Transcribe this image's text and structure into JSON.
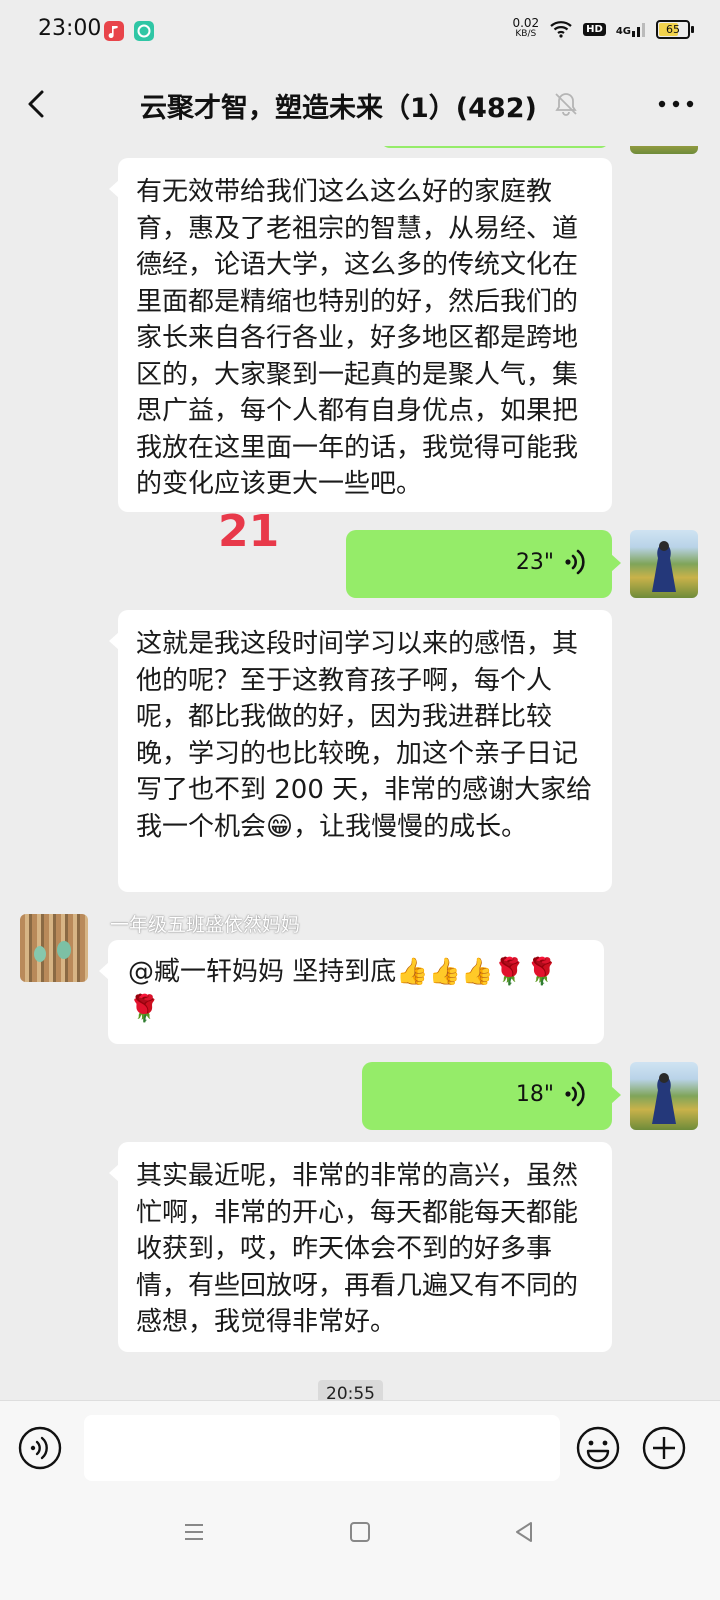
{
  "status_bar": {
    "time": "23:00",
    "net_speed_value": "0.02",
    "net_speed_unit": "KB/S",
    "hd_label": "HD",
    "network": "4G",
    "battery": "65",
    "app_icon_colors": [
      "#e8444a",
      "#2fc6a5"
    ]
  },
  "header": {
    "title": "云聚才智，塑造未来（1）(482)",
    "back_icon": "back-chevron-icon",
    "mute_icon": "bell-muted-icon",
    "more_icon": "more-dots-icon"
  },
  "messages": [
    {
      "type": "text",
      "side": "left",
      "text": "有无效带给我们这么这么好的家庭教育，惠及了老祖宗的智慧，从易经、道德经，论语大学，这么多的传统文化在里面都是精缩也特别的好，然后我们的家长来自各行各业，好多地区都是跨地区的，大家聚到一起真的是聚人气，集思广益，每个人都有自身优点，如果把我放在这里面一年的话，我觉得可能我的变化应该更大一些吧。"
    },
    {
      "type": "voice",
      "side": "right",
      "duration": "23\""
    },
    {
      "type": "text",
      "side": "left",
      "text": "这就是我这段时间学习以来的感悟，其他的呢？至于这教育孩子啊，每个人呢，都比我做的好，因为我进群比较晚，学习的也比较晚，加这个亲子日记写了也不到 200 天，非常的感谢大家给我一个机会😁，让我慢慢的成长。"
    },
    {
      "type": "text",
      "side": "left",
      "sender": "一年级五班盛依然妈妈",
      "text": "@臧一轩妈妈  坚持到底👍👍👍🌹🌹🌹"
    },
    {
      "type": "voice",
      "side": "right",
      "duration": "18\""
    },
    {
      "type": "text",
      "side": "left",
      "text": "其实最近呢，非常的非常的高兴，虽然忙啊，非常的开心，每天都能每天都能收获到，哎，昨天体会不到的好多事情，有些回放呀，再看几遍又有不同的感想，我觉得非常好。"
    }
  ],
  "overlay_marker": "21",
  "timestamp": "20:55",
  "input_bar": {
    "voice_icon": "voice-input-icon",
    "emoji_icon": "emoji-icon",
    "plus_icon": "plus-icon",
    "input_value": ""
  },
  "colors": {
    "background": "#ededed",
    "self_bubble": "#95ec69",
    "other_bubble": "#ffffff",
    "marker": "#e8394a"
  }
}
